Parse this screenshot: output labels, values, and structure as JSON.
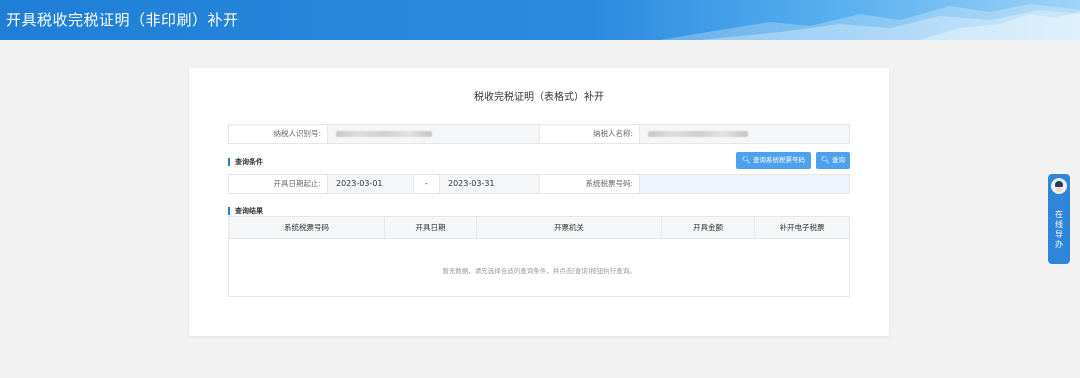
{
  "header": {
    "title": "开具税收完税证明（非印刷）补开"
  },
  "card": {
    "title": "税收完税证明（表格式）补开"
  },
  "taxpayer": {
    "id_label": "纳税人识别号:",
    "name_label": "纳税人名称:"
  },
  "query": {
    "section_label": "查询条件",
    "query_system_button": "查询系统税票号码",
    "query_button": "查询",
    "date_label": "开具日期起止:",
    "date_start": "2023-03-01",
    "date_separator": "-",
    "date_end": "2023-03-31",
    "ticket_label": "系统税票号码:",
    "ticket_value": ""
  },
  "results": {
    "section_label": "查询结果",
    "columns": [
      "系统税票号码",
      "开具日期",
      "开票机关",
      "开具金额",
      "补开电子税票"
    ],
    "empty_message": "暂无数据，请先选择合适的查询条件，并点击[查询]按钮执行查询。"
  },
  "side_guide": {
    "label": "在线导办"
  },
  "icons": {
    "search": "search-icon",
    "avatar": "avatar-icon"
  },
  "colors": {
    "primary": "#1f7fd6",
    "button": "#4ea1ec",
    "background": "#f2f2f2"
  }
}
